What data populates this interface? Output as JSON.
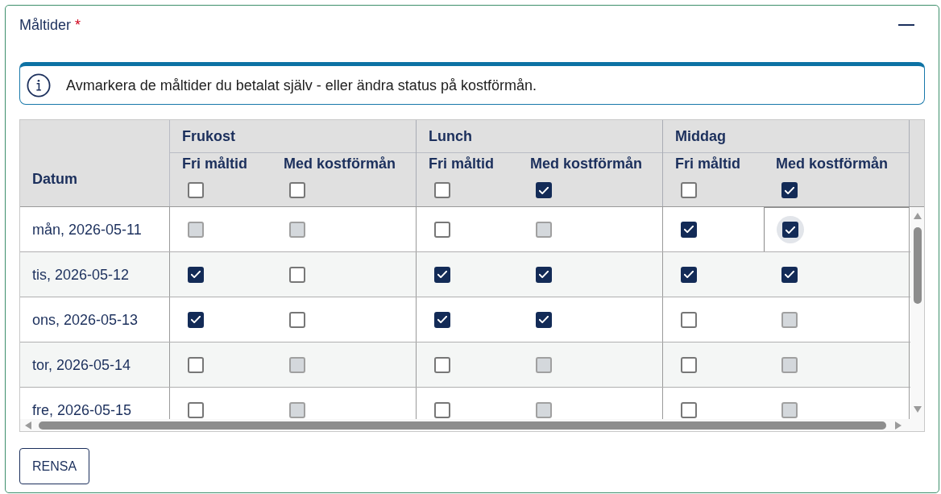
{
  "section": {
    "title": "Måltider",
    "required_mark": "*",
    "expanded": true
  },
  "info": {
    "text": "Avmarkera de måltider du betalat själv - eller ändra status på kostförmån."
  },
  "table": {
    "date_header": "Datum",
    "meals": [
      {
        "label": "Frukost",
        "columns": [
          {
            "label": "Fri måltid",
            "checked": false
          },
          {
            "label": "Med kostförmån",
            "checked": false
          }
        ]
      },
      {
        "label": "Lunch",
        "columns": [
          {
            "label": "Fri måltid",
            "checked": false
          },
          {
            "label": "Med kostförmån",
            "checked": true
          }
        ]
      },
      {
        "label": "Middag",
        "columns": [
          {
            "label": "Fri måltid",
            "checked": false
          },
          {
            "label": "Med kostförmån",
            "checked": true
          }
        ]
      }
    ],
    "rows": [
      {
        "date": "mån, 2026-05-11",
        "cells": [
          {
            "checked": false,
            "disabled": true,
            "focused": false
          },
          {
            "checked": false,
            "disabled": true,
            "focused": false
          },
          {
            "checked": false,
            "disabled": false,
            "focused": false
          },
          {
            "checked": false,
            "disabled": true,
            "focused": false
          },
          {
            "checked": true,
            "disabled": false,
            "focused": false
          },
          {
            "checked": true,
            "disabled": false,
            "focused": true
          }
        ]
      },
      {
        "date": "tis, 2026-05-12",
        "cells": [
          {
            "checked": true,
            "disabled": false,
            "focused": false
          },
          {
            "checked": false,
            "disabled": false,
            "focused": false
          },
          {
            "checked": true,
            "disabled": false,
            "focused": false
          },
          {
            "checked": true,
            "disabled": false,
            "focused": false
          },
          {
            "checked": true,
            "disabled": false,
            "focused": false
          },
          {
            "checked": true,
            "disabled": false,
            "focused": false
          }
        ]
      },
      {
        "date": "ons, 2026-05-13",
        "cells": [
          {
            "checked": true,
            "disabled": false,
            "focused": false
          },
          {
            "checked": false,
            "disabled": false,
            "focused": false
          },
          {
            "checked": true,
            "disabled": false,
            "focused": false
          },
          {
            "checked": true,
            "disabled": false,
            "focused": false
          },
          {
            "checked": false,
            "disabled": false,
            "focused": false
          },
          {
            "checked": false,
            "disabled": true,
            "focused": false
          }
        ]
      },
      {
        "date": "tor, 2026-05-14",
        "cells": [
          {
            "checked": false,
            "disabled": false,
            "focused": false
          },
          {
            "checked": false,
            "disabled": true,
            "focused": false
          },
          {
            "checked": false,
            "disabled": false,
            "focused": false
          },
          {
            "checked": false,
            "disabled": true,
            "focused": false
          },
          {
            "checked": false,
            "disabled": false,
            "focused": false
          },
          {
            "checked": false,
            "disabled": true,
            "focused": false
          }
        ]
      },
      {
        "date": "fre, 2026-05-15",
        "cells": [
          {
            "checked": false,
            "disabled": false,
            "focused": false
          },
          {
            "checked": false,
            "disabled": true,
            "focused": false
          },
          {
            "checked": false,
            "disabled": false,
            "focused": false
          },
          {
            "checked": false,
            "disabled": true,
            "focused": false
          },
          {
            "checked": false,
            "disabled": false,
            "focused": false
          },
          {
            "checked": false,
            "disabled": true,
            "focused": false
          }
        ]
      }
    ]
  },
  "buttons": [
    {
      "label": "RENSA"
    }
  ]
}
